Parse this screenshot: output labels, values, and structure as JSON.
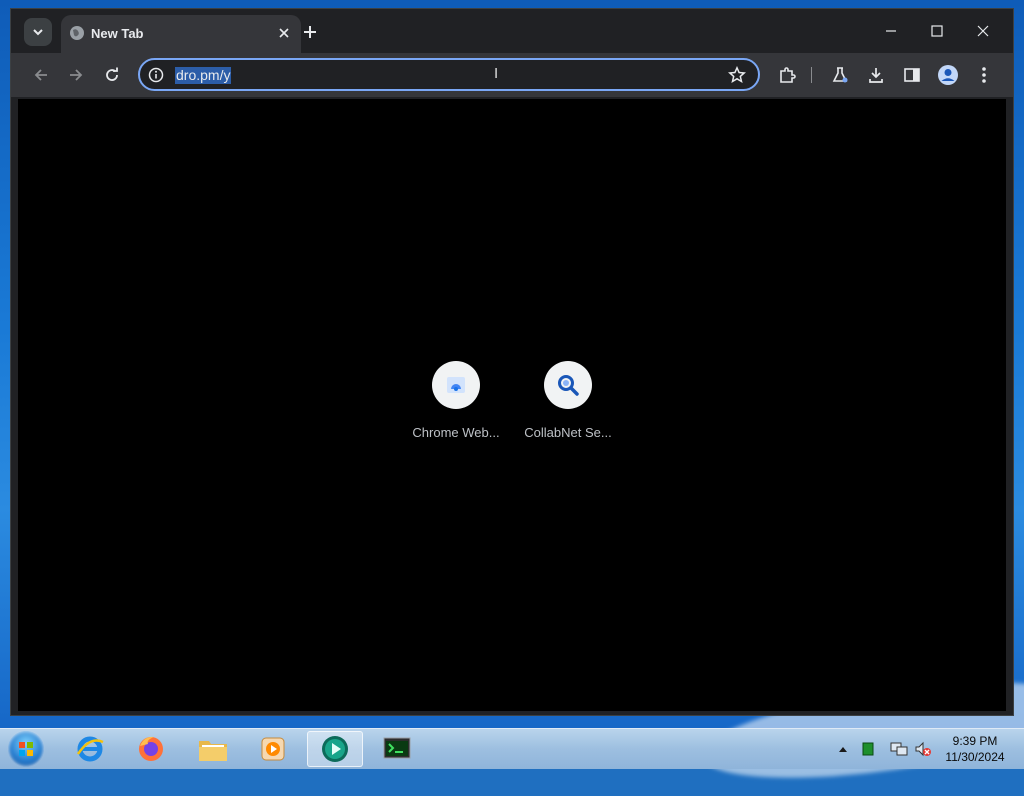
{
  "browser": {
    "tab": {
      "title": "New Tab"
    },
    "omnibox": {
      "value": "dro.pm/y"
    },
    "shortcuts": [
      {
        "label": "Chrome Web..."
      },
      {
        "label": "CollabNet Se..."
      }
    ]
  },
  "taskbar": {
    "clock": {
      "time": "9:39 PM",
      "date": "11/30/2024"
    }
  },
  "colors": {
    "accent": "#7aa7f5",
    "page_bg": "#000000",
    "chrome_bg": "#35363a"
  }
}
